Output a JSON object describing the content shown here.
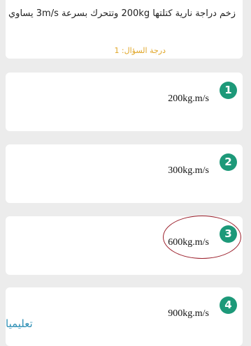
{
  "question": {
    "text": "زخم دراجة نارية كتلتها 200kg وتتحرك بسرعة 3m/s يساوي",
    "points_label": "درجة السؤال: 1"
  },
  "options": [
    {
      "number": "1",
      "value": "200kg.m/s"
    },
    {
      "number": "2",
      "value": "300kg.m/s"
    },
    {
      "number": "3",
      "value": "600kg.m/s"
    },
    {
      "number": "4",
      "value": "900kg.m/s"
    }
  ],
  "selected_option": "3",
  "colors": {
    "number_badge": "#1d9979",
    "points_label": "#e0a526",
    "selection_circle": "#9b1e2a",
    "watermark": "#2d8fb5"
  },
  "watermark": "تعليميا"
}
